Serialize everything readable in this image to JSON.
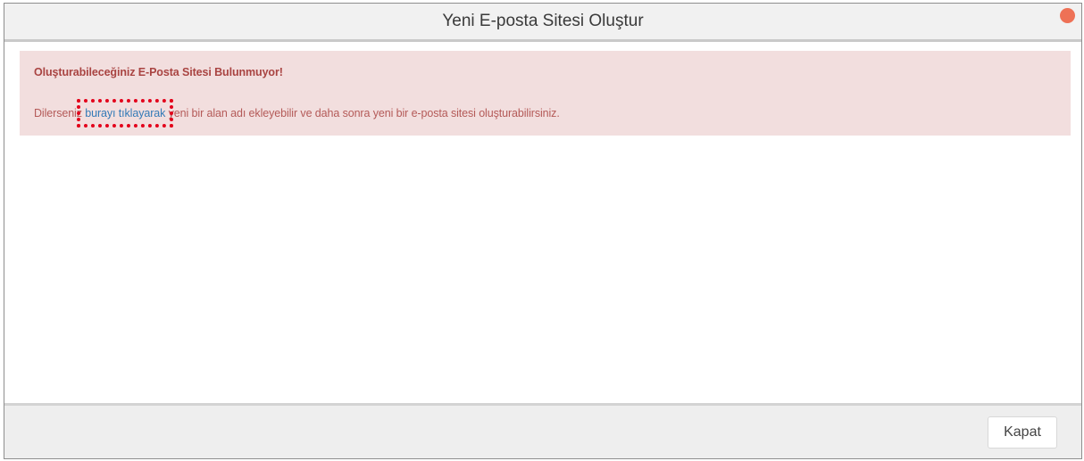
{
  "dialog": {
    "title": "Yeni E-posta Sitesi Oluştur",
    "close_dot_color": "#ee7156"
  },
  "alert": {
    "title": "Oluşturabileceğiniz E-Posta Sitesi Bulunmuyor!",
    "text_before": "Dilerseniz ",
    "link_text": "burayı tıklayarak",
    "text_after": " yeni bir alan adı ekleyebilir ve daha sonra yeni bir e-posta sitesi oluşturabilirsiniz.",
    "background_color": "#f2dede",
    "text_color": "#a94442",
    "link_color": "#337ab7",
    "highlight_color": "#e3001b"
  },
  "footer": {
    "close_label": "Kapat"
  }
}
